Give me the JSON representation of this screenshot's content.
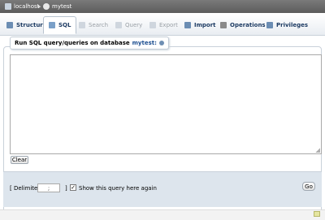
{
  "breadcrumb": {
    "server": "localhost",
    "database": "mytest"
  },
  "tabs": [
    {
      "label": "Structure",
      "icon": "structure-icon",
      "state": "normal"
    },
    {
      "label": "SQL",
      "icon": "sql-icon",
      "state": "active"
    },
    {
      "label": "Search",
      "icon": "search-icon",
      "state": "disabled"
    },
    {
      "label": "Query",
      "icon": "query-icon",
      "state": "disabled"
    },
    {
      "label": "Export",
      "icon": "export-icon",
      "state": "disabled"
    },
    {
      "label": "Import",
      "icon": "import-icon",
      "state": "normal"
    },
    {
      "label": "Operations",
      "icon": "wrench-icon",
      "state": "normal"
    },
    {
      "label": "Privileges",
      "icon": "privileges-icon",
      "state": "normal"
    }
  ],
  "sql_panel": {
    "legend_prefix": "Run SQL query/queries on database",
    "database_link": "mytest:",
    "query_text": "",
    "clear_label": "Clear"
  },
  "options": {
    "delimiter_label": "[ Delimiter",
    "delimiter_value": ";",
    "separator": "]",
    "show_query_checked": true,
    "show_query_label": "Show this query here again",
    "go_label": "Go"
  },
  "colors": {
    "accent": "#1d3b63",
    "panel": "#dde5ed",
    "topbar": "#666666"
  }
}
